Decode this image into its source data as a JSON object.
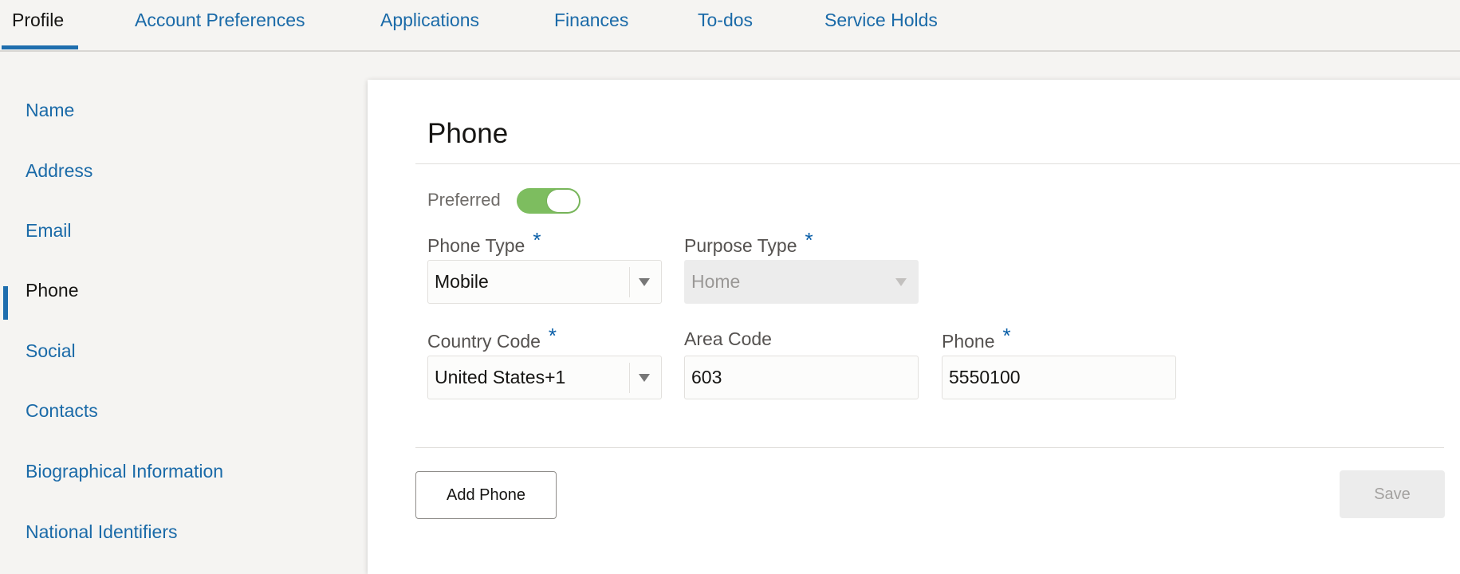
{
  "tabs": [
    {
      "label": "Profile",
      "active": true
    },
    {
      "label": "Account Preferences"
    },
    {
      "label": "Applications"
    },
    {
      "label": "Finances"
    },
    {
      "label": "To-dos"
    },
    {
      "label": "Service Holds"
    }
  ],
  "sidebar": {
    "items": [
      {
        "label": "Name"
      },
      {
        "label": "Address"
      },
      {
        "label": "Email"
      },
      {
        "label": "Phone",
        "active": true
      },
      {
        "label": "Social"
      },
      {
        "label": "Contacts"
      },
      {
        "label": "Biographical Information"
      },
      {
        "label": "National Identifiers"
      }
    ]
  },
  "card": {
    "title": "Phone",
    "preferred": {
      "label": "Preferred",
      "on": true
    },
    "required_mark": "*",
    "phone_type": {
      "label": "Phone Type",
      "value": "Mobile"
    },
    "purpose_type": {
      "label": "Purpose Type",
      "value": "Home",
      "disabled": true
    },
    "country_code": {
      "label": "Country Code",
      "value": "United States+1"
    },
    "area_code": {
      "label": "Area Code",
      "value": "603"
    },
    "phone": {
      "label": "Phone",
      "value": "5550100"
    },
    "add_button": "Add Phone",
    "save_button": "Save"
  },
  "colors": {
    "accent": "#1f6eae",
    "link": "#1a6aa8",
    "toggle_on": "#7dbd5f",
    "required": "#0a5fa8"
  }
}
